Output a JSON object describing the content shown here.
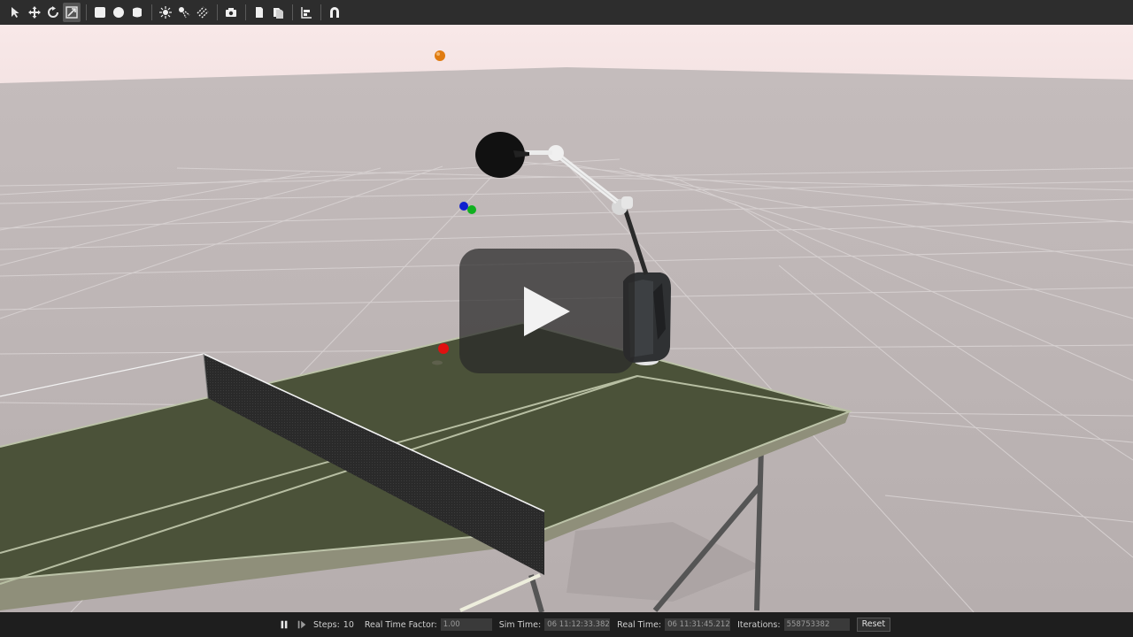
{
  "toolbar": {
    "tools": [
      {
        "name": "select-mode-icon"
      },
      {
        "name": "translate-mode-icon"
      },
      {
        "name": "rotate-mode-icon"
      },
      {
        "name": "scale-mode-icon"
      },
      {
        "name": "box-shape-icon"
      },
      {
        "name": "sphere-shape-icon"
      },
      {
        "name": "cylinder-shape-icon"
      },
      {
        "name": "point-light-icon"
      },
      {
        "name": "spot-light-icon"
      },
      {
        "name": "directional-light-icon"
      },
      {
        "name": "screenshot-icon"
      },
      {
        "name": "copy-icon"
      },
      {
        "name": "paste-icon"
      },
      {
        "name": "align-icon"
      },
      {
        "name": "snap-icon"
      }
    ]
  },
  "statusbar": {
    "steps_label": "Steps:",
    "steps_value": "10",
    "rtf_label": "Real Time Factor:",
    "rtf_value": "1.00",
    "sim_time_label": "Sim Time:",
    "sim_time_value": "06 11:12:33.382",
    "real_time_label": "Real Time:",
    "real_time_value": "06 11:31:45.212",
    "iterations_label": "Iterations:",
    "iterations_value": "558753382",
    "reset_label": "Reset"
  },
  "colors": {
    "sky": "#f7e6e6",
    "ground": "#bdb5b5",
    "table": "#4b5239",
    "ball_orange": "#e07b10",
    "ball_red": "#e01010",
    "ball_blue": "#1020d0",
    "ball_green": "#10b020"
  }
}
